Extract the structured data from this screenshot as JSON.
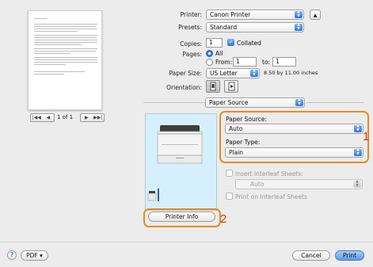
{
  "preview": {
    "page_indicator": "1 of 1",
    "first_icon": "first-page-icon",
    "prev_icon": "previous-page-icon",
    "next_icon": "next-page-icon",
    "last_icon": "last-page-icon"
  },
  "printer": {
    "label": "Printer:",
    "value": "Canon Printer"
  },
  "presets": {
    "label": "Presets:",
    "value": "Standard"
  },
  "copies": {
    "label": "Copies:",
    "value": "1",
    "collated_label": "Collated"
  },
  "pages": {
    "label": "Pages:",
    "all_label": "All",
    "from_label": "From:",
    "from_value": "1",
    "to_label": "to:",
    "to_value": "1"
  },
  "paper_size": {
    "label": "Paper Size:",
    "value": "US Letter",
    "dims": "8.50 by 11.00 inches"
  },
  "orientation": {
    "label": "Orientation:"
  },
  "section_popup": {
    "value": "Paper Source"
  },
  "paper_source": {
    "label": "Paper Source:",
    "value": "Auto"
  },
  "paper_type": {
    "label": "Paper Type:",
    "value": "Plain"
  },
  "interleaf": {
    "insert_label": "Insert Interleaf Sheets:",
    "value": "Auto",
    "print_on_label": "Print on Interleaf Sheets"
  },
  "printer_info_button": "Printer Info",
  "callouts": {
    "one": "1",
    "two": "2"
  },
  "footer": {
    "help": "?",
    "pdf": "PDF ▾",
    "cancel": "Cancel",
    "print": "Print"
  },
  "colors": {
    "accent": "#2e74e0",
    "callout_border": "#e98a1f",
    "callout_number": "#d4350f",
    "preview_bg": "#d5f0fc"
  }
}
